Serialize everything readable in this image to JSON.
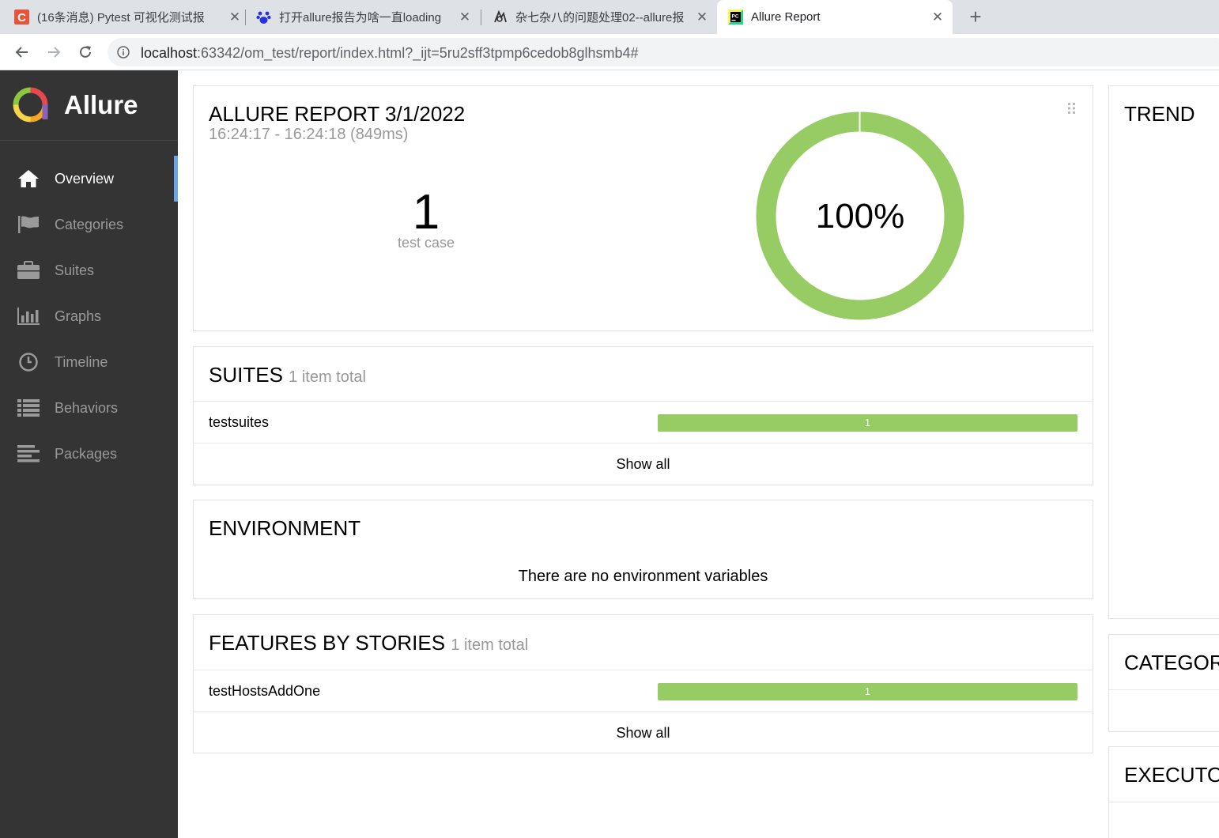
{
  "browser": {
    "tabs": [
      {
        "title": "(16条消息) Pytest 可视化测试报",
        "close": "✕"
      },
      {
        "title": "打开allure报告为啥一直loading",
        "close": "✕"
      },
      {
        "title": "杂七杂八的问题处理02--allure报",
        "close": "✕"
      },
      {
        "title": "Allure Report",
        "close": "✕"
      }
    ],
    "new_tab": "+",
    "url_host": "localhost",
    "url_rest": ":63342/om_test/report/index.html?_ijt=5ru2sff3tpmp6cedob8glhsmb4#"
  },
  "sidebar": {
    "brand": "Allure",
    "items": [
      {
        "label": "Overview",
        "icon": "home-icon",
        "active": true
      },
      {
        "label": "Categories",
        "icon": "flag-icon"
      },
      {
        "label": "Suites",
        "icon": "briefcase-icon"
      },
      {
        "label": "Graphs",
        "icon": "bar-chart-icon"
      },
      {
        "label": "Timeline",
        "icon": "clock-icon"
      },
      {
        "label": "Behaviors",
        "icon": "list-icon"
      },
      {
        "label": "Packages",
        "icon": "align-left-icon"
      }
    ]
  },
  "summary": {
    "title": "ALLURE REPORT 3/1/2022",
    "dates": "16:24:17 - 16:24:18 (849ms)",
    "count": "1",
    "count_label": "test case",
    "percent": "100%",
    "passed_fraction": 1.0
  },
  "suites": {
    "title": "SUITES",
    "subtitle": "1 item total",
    "rows": [
      {
        "label": "testsuites",
        "value": "1"
      }
    ],
    "show_all": "Show all"
  },
  "environment": {
    "title": "ENVIRONMENT",
    "empty": "There are no environment variables"
  },
  "features": {
    "title": "FEATURES BY STORIES",
    "subtitle": "1 item total",
    "rows": [
      {
        "label": "testHostsAddOne",
        "value": "1"
      }
    ],
    "show_all": "Show all"
  },
  "right": {
    "trend": "TREND",
    "categories": "CATEGOR",
    "executors": "EXECUTO"
  },
  "colors": {
    "passed": "#97cc64",
    "sidebar": "#343434",
    "active_indicator": "#6aa6e6"
  }
}
